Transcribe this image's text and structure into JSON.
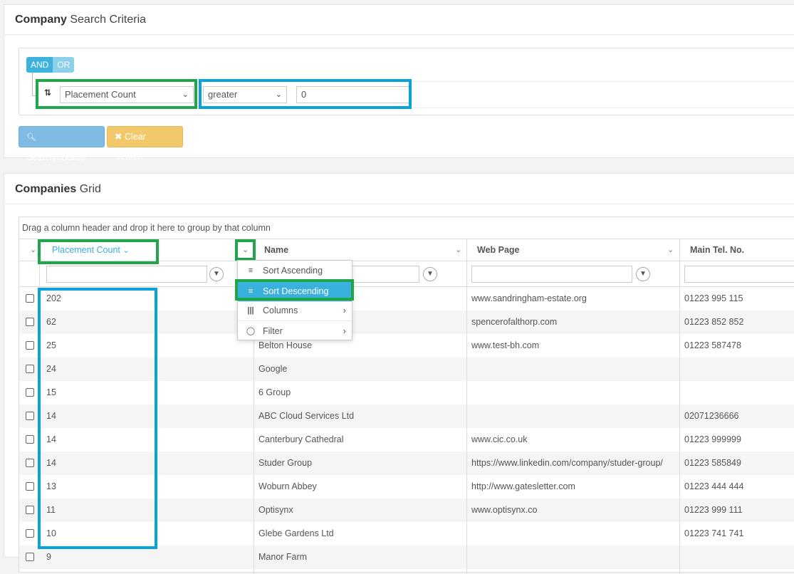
{
  "criteria": {
    "title_bold": "Company",
    "title_rest": " Search Criteria",
    "and_label": "AND",
    "or_label": "OR",
    "field_value": "Placement Count",
    "operator_value": "greater",
    "value": "0",
    "search_label": "Search/Lookup",
    "clear_label": "Clear Search"
  },
  "grid": {
    "title_bold": "Companies",
    "title_rest": " Grid",
    "group_hint": "Drag a column header and drop it here to group by that column",
    "columns": {
      "placement": "Placement Count",
      "name": "Name",
      "web": "Web Page",
      "tel": "Main Tel. No."
    },
    "rows": [
      {
        "count": "202",
        "name": "",
        "web": "www.sandringham-estate.org",
        "tel": "01223 995 115"
      },
      {
        "count": "62",
        "name": "",
        "web": "spencerofalthorp.com",
        "tel": "01223 852 852"
      },
      {
        "count": "25",
        "name": "Belton House",
        "web": "www.test-bh.com",
        "tel": "01223 587478"
      },
      {
        "count": "24",
        "name": "Google",
        "web": "",
        "tel": ""
      },
      {
        "count": "15",
        "name": "6 Group",
        "web": "",
        "tel": ""
      },
      {
        "count": "14",
        "name": "ABC Cloud Services Ltd",
        "web": "",
        "tel": "02071236666"
      },
      {
        "count": "14",
        "name": "Canterbury Cathedral",
        "web": "www.cic.co.uk",
        "tel": "01223 999999"
      },
      {
        "count": "14",
        "name": "Studer Group",
        "web": "https://www.linkedin.com/company/studer-group/",
        "tel": "01223 585849"
      },
      {
        "count": "13",
        "name": "Woburn Abbey",
        "web": "http://www.gatesletter.com",
        "tel": "01223 444 444"
      },
      {
        "count": "11",
        "name": "Optisynx",
        "web": "www.optisynx.co",
        "tel": "01223 999 111"
      },
      {
        "count": "10",
        "name": "Glebe Gardens Ltd",
        "web": "",
        "tel": "01223 741 741"
      },
      {
        "count": "9",
        "name": "Manor Farm",
        "web": "",
        "tel": ""
      }
    ]
  },
  "menu": {
    "items": [
      {
        "label": "Sort Ascending",
        "icon": "sort-ascending-icon"
      },
      {
        "label": "Sort Descending",
        "icon": "sort-descending-icon"
      },
      {
        "label": "Columns",
        "icon": "columns-icon"
      },
      {
        "label": "Filter",
        "icon": "filter-icon"
      }
    ]
  },
  "colors": {
    "highlight_green": "#1fa54a",
    "highlight_blue": "#0aa2dc",
    "accent": "#3ab0dc",
    "search_button": "#7fbbe4",
    "clear_button": "#f3c86b"
  }
}
